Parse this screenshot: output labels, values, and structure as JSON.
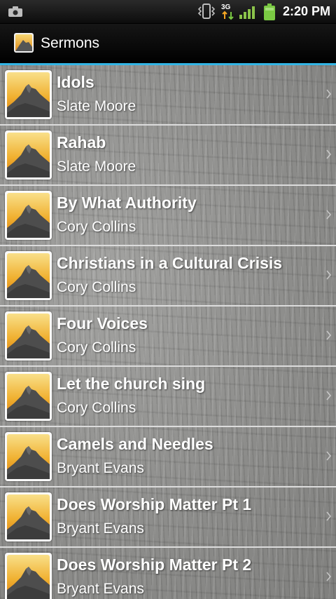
{
  "status_bar": {
    "time": "2:20 PM",
    "network": "3G",
    "icons": [
      "camera-icon",
      "vibrate-icon",
      "3g-data-icon",
      "signal-icon",
      "battery-icon"
    ],
    "battery_color": "#7ac943",
    "signal_color": "#8bc34a"
  },
  "app": {
    "title": "Sermons",
    "accent_color": "#33b5e5"
  },
  "sermons": [
    {
      "title": "Idols",
      "speaker": "Slate Moore"
    },
    {
      "title": "Rahab",
      "speaker": "Slate Moore"
    },
    {
      "title": "By What Authority",
      "speaker": "Cory Collins"
    },
    {
      "title": "Christians in a Cultural Crisis",
      "speaker": "Cory Collins"
    },
    {
      "title": "Four Voices",
      "speaker": "Cory Collins"
    },
    {
      "title": "Let the church sing",
      "speaker": "Cory Collins"
    },
    {
      "title": "Camels and Needles",
      "speaker": "Bryant Evans"
    },
    {
      "title": "Does Worship Matter Pt 1",
      "speaker": "Bryant Evans"
    },
    {
      "title": "Does Worship Matter Pt 2",
      "speaker": "Bryant Evans"
    }
  ]
}
